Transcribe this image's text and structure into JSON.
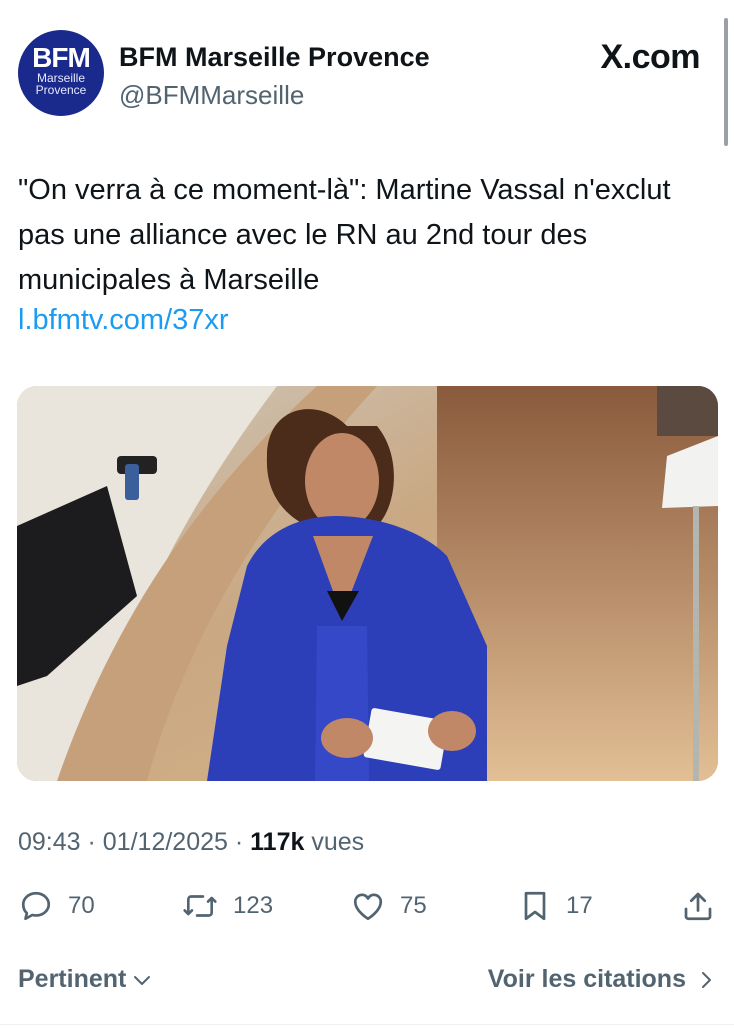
{
  "account": {
    "avatar_logo": "BFM",
    "avatar_sub_line1": "Marseille",
    "avatar_sub_line2": "Provence",
    "name": "BFM Marseille Provence",
    "handle": "@BFMMarseille"
  },
  "brand": "X.com",
  "tweet": {
    "text": "\"On verra à ce moment-là\": Martine Vassal n'exclut pas une alliance avec le RN au 2nd tour des municipales à Marseille",
    "link": "l.bfmtv.com/37xr"
  },
  "meta": {
    "time": "09:43",
    "date": "01/12/2025",
    "views_count": "117k",
    "views_label": "vues"
  },
  "actions": {
    "replies": "70",
    "reposts": "123",
    "likes": "75",
    "bookmarks": "17"
  },
  "footer": {
    "sort_label": "Pertinent",
    "quotes_label": "Voir les citations"
  },
  "colors": {
    "link": "#1d9bf0",
    "muted": "#536471",
    "avatar_bg": "#1a2a8c",
    "blazer": "#2c3fb8"
  },
  "icons": [
    "reply-icon",
    "repost-icon",
    "like-icon",
    "bookmark-icon",
    "share-icon",
    "chevron-down-icon",
    "chevron-right-icon"
  ]
}
